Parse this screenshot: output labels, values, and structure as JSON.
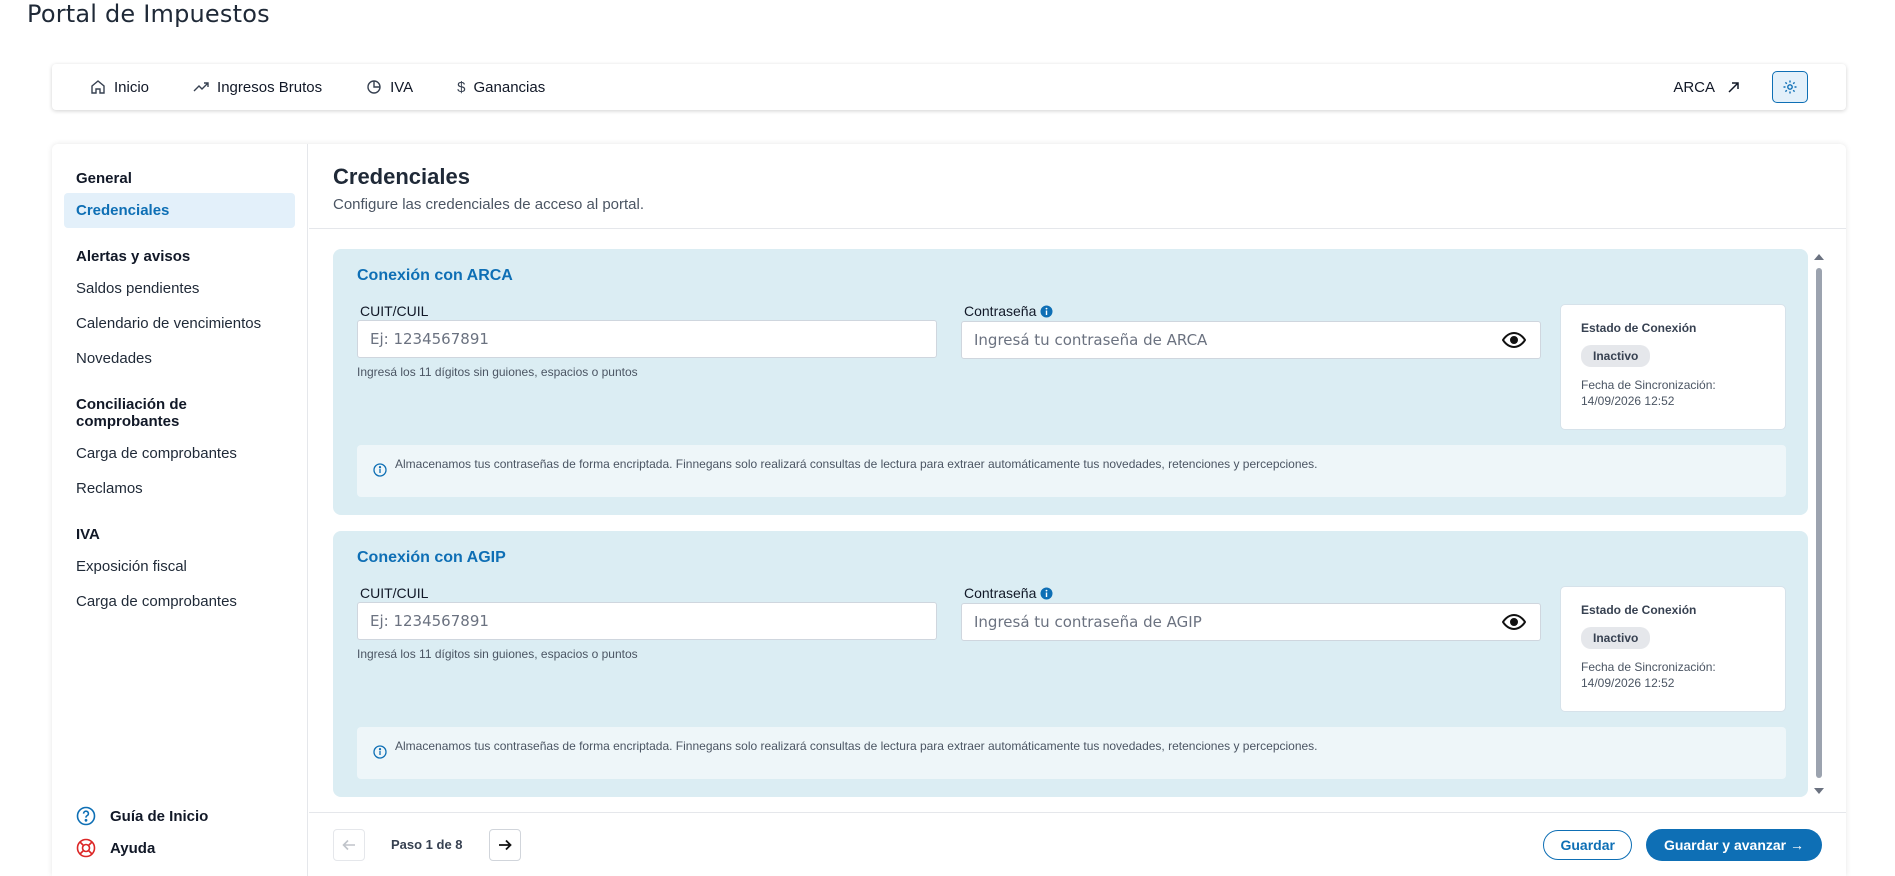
{
  "app": {
    "title": "Portal de Impuestos"
  },
  "nav": {
    "items": [
      {
        "label": "Inicio",
        "icon": "home-icon"
      },
      {
        "label": "Ingresos Brutos",
        "icon": "trending-up-icon"
      },
      {
        "label": "IVA",
        "icon": "pie-chart-icon"
      },
      {
        "label": "Ganancias",
        "icon": "dollar-icon"
      }
    ],
    "external_link": "ARCA",
    "accent": "#0e6fb5"
  },
  "sidebar": {
    "sections": [
      {
        "title": "General",
        "items": [
          "Credenciales"
        ]
      },
      {
        "title": "Alertas y avisos",
        "items": [
          "Saldos pendientes",
          "Calendario de vencimientos",
          "Novedades"
        ]
      },
      {
        "title": "Conciliación de comprobantes",
        "items": [
          "Carga de comprobantes",
          "Reclamos"
        ]
      },
      {
        "title": "IVA",
        "items": [
          "Exposición fiscal",
          "Carga de comprobantes"
        ]
      }
    ],
    "active": "Credenciales",
    "bottom": {
      "guide": "Guía de Inicio",
      "help": "Ayuda"
    }
  },
  "main": {
    "title": "Credenciales",
    "subtitle": "Configure las credenciales de acceso al portal.",
    "panels": [
      {
        "title": "Conexión con ARCA",
        "cuit_label": "CUIT/CUIL",
        "cuit_placeholder": "Ej: 1234567891",
        "cuit_hint": "Ingresá los 11 dígitos sin guiones, espacios o puntos",
        "password_label": "Contraseña",
        "password_placeholder": "Ingresá tu contraseña de ARCA",
        "status_title": "Estado de Conexión",
        "status_badge": "Inactivo",
        "sync_label": "Fecha de Sincronización:",
        "sync_date": "14/09/2026 12:52",
        "info": "Almacenamos tus contraseñas de forma encriptada. Finnegans solo realizará consultas de lectura para extraer automáticamente tus novedades, retenciones y percepciones."
      },
      {
        "title": "Conexión con AGIP",
        "cuit_label": "CUIT/CUIL",
        "cuit_placeholder": "Ej: 1234567891",
        "cuit_hint": "Ingresá los 11 dígitos sin guiones, espacios o puntos",
        "password_label": "Contraseña",
        "password_placeholder": "Ingresá tu contraseña de AGIP",
        "status_title": "Estado de Conexión",
        "status_badge": "Inactivo",
        "sync_label": "Fecha de Sincronización:",
        "sync_date": "14/09/2026 12:52",
        "info": "Almacenamos tus contraseñas de forma encriptada. Finnegans solo realizará consultas de lectura para extraer automáticamente tus novedades, retenciones y percepciones."
      }
    ]
  },
  "footer": {
    "step_text": "Paso 1 de 8",
    "save": "Guardar",
    "save_next": "Guardar y avanzar →"
  }
}
